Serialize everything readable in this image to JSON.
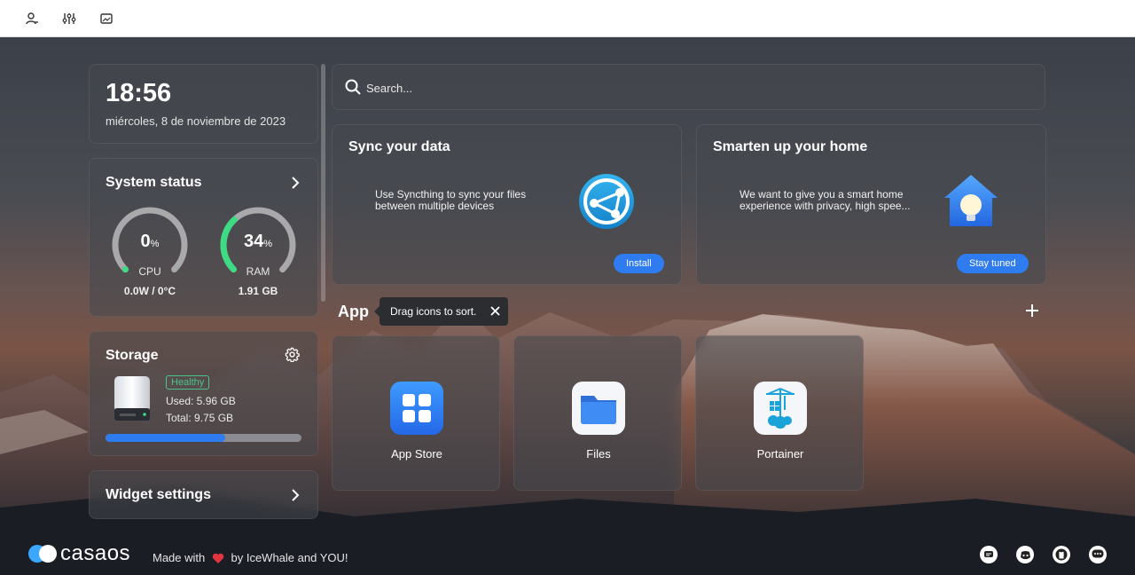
{
  "topbar": {
    "icons": [
      "user-settings-icon",
      "sliders-icon",
      "wallpaper-icon"
    ]
  },
  "clock": {
    "time": "18:56",
    "date": "miércoles, 8 de noviembre de 2023"
  },
  "system_status": {
    "title": "System status",
    "cpu": {
      "value": "0",
      "unit": "%",
      "label": "CPU",
      "sub": "0.0W / 0°C",
      "percent": 0
    },
    "ram": {
      "value": "34",
      "unit": "%",
      "label": "RAM",
      "sub": "1.91 GB",
      "percent": 34
    }
  },
  "storage": {
    "title": "Storage",
    "badge": "Healthy",
    "used": "Used: 5.96 GB",
    "total": "Total: 9.75 GB",
    "used_fraction": 0.61
  },
  "widget_settings": {
    "label": "Widget settings"
  },
  "search": {
    "placeholder": "Search..."
  },
  "promos": [
    {
      "title": "Sync your data",
      "desc": "Use Syncthing to sync your files between multiple devices",
      "button": "Install",
      "icon": "syncthing-icon"
    },
    {
      "title": "Smarten up your home",
      "desc": "We want to give you a smart home experience with privacy, high spee...",
      "button": "Stay tuned",
      "icon": "smart-home-icon"
    }
  ],
  "apps_section": {
    "title": "App",
    "tooltip": "Drag icons to sort.",
    "apps": [
      {
        "label": "App Store",
        "icon": "app-store-icon"
      },
      {
        "label": "Files",
        "icon": "files-icon"
      },
      {
        "label": "Portainer",
        "icon": "portainer-icon"
      }
    ]
  },
  "footer": {
    "brand": "casaos",
    "made_with": "Made with",
    "by": "by IceWhale and YOU!",
    "icons": [
      "chat-icon",
      "discord-icon",
      "github-icon",
      "more-icon"
    ]
  },
  "colors": {
    "accent": "#2f7bf0",
    "gauge_green": "#3ddc84",
    "healthy": "#4cc38a",
    "heart": "#e0343f"
  }
}
